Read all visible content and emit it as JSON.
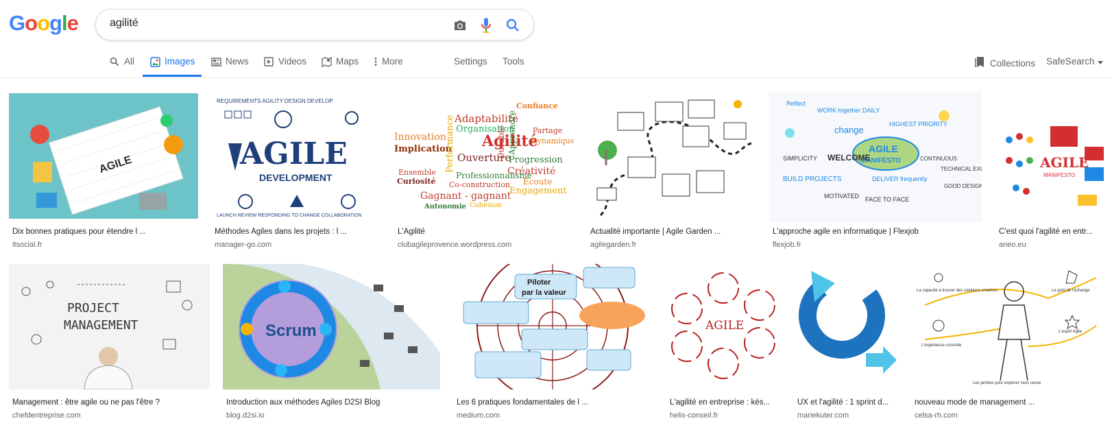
{
  "logo": {
    "letters": [
      "G",
      "o",
      "o",
      "g",
      "l",
      "e"
    ],
    "colors": [
      "#4285f4",
      "#ea4335",
      "#fbbc05",
      "#4285f4",
      "#34a853",
      "#ea4335"
    ]
  },
  "search": {
    "value": "agilité"
  },
  "icons": {
    "camera": "camera-icon",
    "mic": "microphone-icon",
    "search": "search-icon"
  },
  "tabs": [
    {
      "label": "All",
      "icon": "search-icon"
    },
    {
      "label": "Images",
      "icon": "image-icon",
      "active": true
    },
    {
      "label": "News",
      "icon": "news-icon"
    },
    {
      "label": "Videos",
      "icon": "play-icon"
    },
    {
      "label": "Maps",
      "icon": "map-icon"
    },
    {
      "label": "More",
      "icon": "more-vert-icon"
    }
  ],
  "tools": {
    "settings": "Settings",
    "tools": "Tools",
    "collections": "Collections",
    "safesearch": "SafeSearch"
  },
  "results": [
    {
      "title": "Dix bonnes pratiques pour étendre l ...",
      "source": "itsocial.fr",
      "thumb": {
        "bg": "#6cc3c8",
        "text": "AGILE",
        "textColor": "#2b2b2b"
      }
    },
    {
      "title": "Méthodes Agiles dans les projets : l ...",
      "source": "manager-go.com",
      "thumb": {
        "bg": "#ffffff",
        "text": "AGILE",
        "sub": "DEVELOPMENT",
        "textColor": "#1f3f7a"
      }
    },
    {
      "title": "L'Agilité",
      "source": "clubagileprovence.wordpress.com",
      "thumb": {
        "bg": "#ffffff",
        "text": "Agilité",
        "textColor": "#d32f2f"
      }
    },
    {
      "title": "Actualité importante | Agile Garden ...",
      "source": "agilegarden.fr",
      "thumb": {
        "bg": "#ffffff",
        "text": "",
        "textColor": "#333333"
      }
    },
    {
      "title": "L'approche agile en informatique | Flexjob",
      "source": "flexjob.fr",
      "thumb": {
        "bg": "#f6f8fb",
        "text": "AGILE",
        "sub": "MANIFESTO",
        "textColor": "#1e88e5"
      }
    },
    {
      "title": "C'est quoi l'agilité en entr...",
      "source": "aneo.eu",
      "thumb": {
        "bg": "#ffffff",
        "text": "AGILE",
        "sub": "MANIFESTO",
        "textColor": "#d32f2f"
      }
    },
    {
      "title": "Management : être agile ou ne pas l'être ?",
      "source": "chefdentreprise.com",
      "thumb": {
        "bg": "#f3f3f3",
        "text": "PROJECT",
        "sub": "MANAGEMENT",
        "textColor": "#333333"
      }
    },
    {
      "title": "Introduction aux méthodes Agiles D2SI Blog",
      "source": "blog.d2si.io",
      "thumb": {
        "bg": "#ffffff",
        "text": "Scrum",
        "textColor": "#1e4f8f"
      }
    },
    {
      "title": "Les 6 pratiques fondamentales de l ...",
      "source": "medium.com",
      "thumb": {
        "bg": "#ffffff",
        "text": "Piloter",
        "sub": "par la valeur",
        "textColor": "#1a1a1a"
      }
    },
    {
      "title": "L'agilité en entreprise : kés...",
      "source": "helis-conseil.fr",
      "thumb": {
        "bg": "#ffffff",
        "text": "AGILE",
        "textColor": "#b71c1c"
      }
    },
    {
      "title": "UX et l'agilité : 1 sprint d...",
      "source": "mariekuter.com",
      "thumb": {
        "bg": "#ffffff",
        "text": "",
        "textColor": "#1e73be"
      }
    },
    {
      "title": "nouveau mode de management ...",
      "source": "celsa-rh.com",
      "thumb": {
        "bg": "#ffffff",
        "text": "",
        "textColor": "#333333"
      }
    }
  ]
}
